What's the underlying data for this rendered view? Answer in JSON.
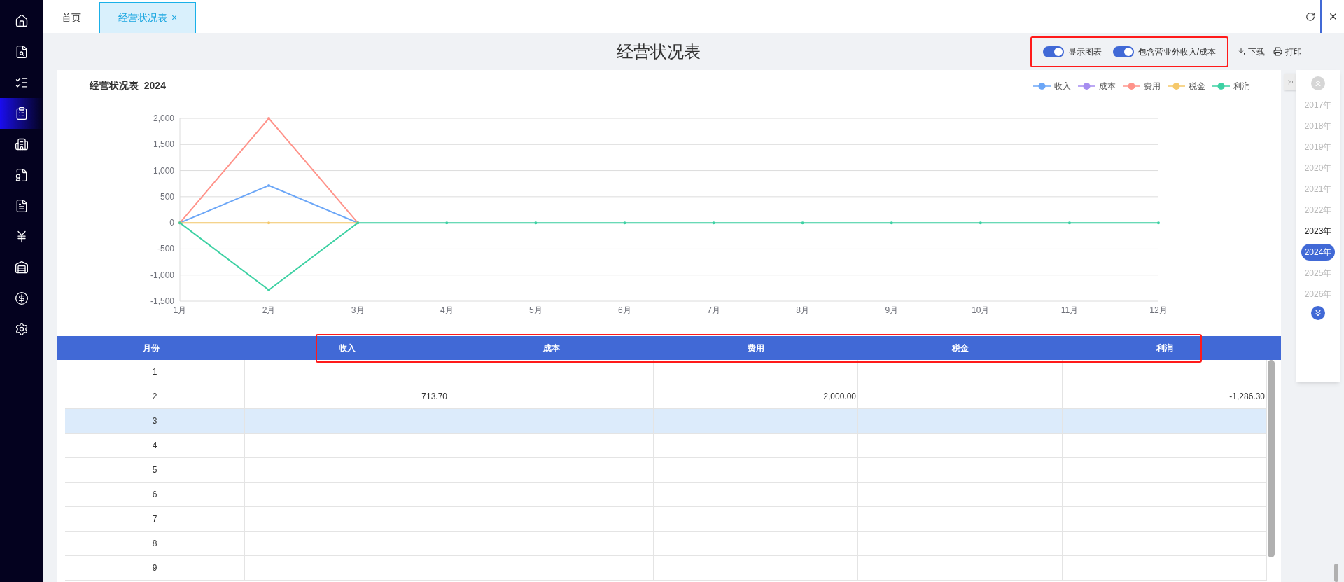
{
  "sidebar": {
    "items": [
      {
        "selected": false
      },
      {
        "selected": false
      },
      {
        "selected": false
      },
      {
        "selected": true
      },
      {
        "selected": false
      },
      {
        "selected": false
      },
      {
        "selected": false
      },
      {
        "selected": false
      },
      {
        "selected": false
      },
      {
        "selected": false
      },
      {
        "selected": false
      }
    ]
  },
  "tabs": [
    {
      "label": "首页",
      "selected": false,
      "closable": false
    },
    {
      "label": "经营状况表",
      "selected": true,
      "closable": true,
      "close_glyph": "×"
    }
  ],
  "page_title": "经营状况表",
  "toolbar": {
    "toggles": [
      {
        "label": "显示图表",
        "on": true
      },
      {
        "label": "包含营业外收入/成本",
        "on": true
      }
    ],
    "download": "下载",
    "print": "打印"
  },
  "chart": {
    "title": "经营状况表_2024",
    "chart_data": {
      "type": "line",
      "categories": [
        "1月",
        "2月",
        "3月",
        "4月",
        "5月",
        "6月",
        "7月",
        "8月",
        "9月",
        "10月",
        "11月",
        "12月"
      ],
      "ylim": [
        -1500,
        2000
      ],
      "yticks": [
        {
          "value": 2000,
          "label": "2,000"
        },
        {
          "value": 1500,
          "label": "1,500"
        },
        {
          "value": 1000,
          "label": "1,000"
        },
        {
          "value": 500,
          "label": "500"
        },
        {
          "value": 0,
          "label": "0"
        },
        {
          "value": -500,
          "label": "-500"
        },
        {
          "value": -1000,
          "label": "-1,000"
        },
        {
          "value": -1500,
          "label": "-1,500"
        }
      ],
      "series": [
        {
          "name": "收入",
          "color": "#6ba6f7",
          "values": [
            0,
            714,
            0,
            null,
            null,
            null,
            null,
            null,
            null,
            null,
            null,
            null
          ]
        },
        {
          "name": "成本",
          "color": "#a68df0",
          "values": [
            null,
            null,
            null,
            null,
            null,
            null,
            null,
            null,
            null,
            null,
            null,
            null
          ]
        },
        {
          "name": "费用",
          "color": "#ff938a",
          "values": [
            0,
            2000,
            0,
            null,
            null,
            null,
            null,
            null,
            null,
            null,
            null,
            null
          ]
        },
        {
          "name": "税金",
          "color": "#f5c86a",
          "values": [
            0,
            0,
            0,
            null,
            null,
            null,
            null,
            null,
            null,
            null,
            null,
            null
          ]
        },
        {
          "name": "利润",
          "color": "#3dd1a3",
          "values": [
            0,
            -1286,
            0,
            0,
            0,
            0,
            0,
            0,
            0,
            0,
            0,
            0
          ]
        }
      ],
      "grid": true
    }
  },
  "table": {
    "month_column": "月份",
    "columns": [
      {
        "label": "收入"
      },
      {
        "label": "成本"
      },
      {
        "label": "费用"
      },
      {
        "label": "税金"
      },
      {
        "label": "利润"
      }
    ],
    "rows": [
      {
        "month": "1",
        "highlighted": false
      },
      {
        "month": "2",
        "highlighted": false,
        "cells": [
          "713.70",
          null,
          "2,000.00",
          null,
          "-1,286.30"
        ]
      },
      {
        "month": "3",
        "highlighted": true
      },
      {
        "month": "4",
        "highlighted": false
      },
      {
        "month": "5",
        "highlighted": false
      },
      {
        "month": "6",
        "highlighted": false
      },
      {
        "month": "7",
        "highlighted": false
      },
      {
        "month": "8",
        "highlighted": false
      },
      {
        "month": "9",
        "highlighted": false
      }
    ]
  },
  "years": [
    {
      "label": "2017年",
      "selected": false,
      "current": false
    },
    {
      "label": "2018年",
      "selected": false,
      "current": false
    },
    {
      "label": "2019年",
      "selected": false,
      "current": false
    },
    {
      "label": "2020年",
      "selected": false,
      "current": false
    },
    {
      "label": "2021年",
      "selected": false,
      "current": false
    },
    {
      "label": "2022年",
      "selected": false,
      "current": false
    },
    {
      "label": "2023年",
      "selected": false,
      "current": true
    },
    {
      "label": "2024年",
      "selected": true,
      "current": false
    },
    {
      "label": "2025年",
      "selected": false,
      "current": false
    },
    {
      "label": "2026年",
      "selected": false,
      "current": false
    }
  ]
}
